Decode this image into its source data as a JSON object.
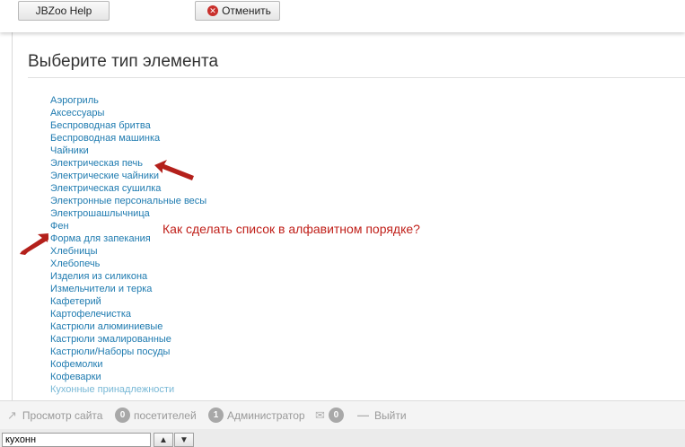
{
  "toolbar": {
    "help_label": "JBZoo Help",
    "cancel_label": "Отменить"
  },
  "page": {
    "title": "Выберите тип элемента"
  },
  "element_types": [
    "Аэрогриль",
    "Аксессуары",
    "Беспроводная бритва",
    "Беспроводная машинка",
    "Чайники",
    "Электрическая печь",
    "Электрические чайники",
    "Электрическая сушилка",
    "Электронные персональные весы",
    "Электрошашлычница",
    "Фен",
    "Форма для запекания",
    "Хлебницы",
    "Хлебопечь",
    "Изделия из силикона",
    "Измельчители и терка",
    "Кафетерий",
    "Картофелечистка",
    "Кастрюли алюминиевые",
    "Кастрюли эмалированные",
    "Кастрюли/Наборы посуды",
    "Кофемолки",
    "Кофеварки",
    "Кухонные принадлежности"
  ],
  "annotation": {
    "question": "Как сделать список в алфавитном порядке?"
  },
  "statusbar": {
    "view_site": "Просмотр сайта",
    "visitors_count": "0",
    "visitors_label": "посетителей",
    "admin_count": "1",
    "admin_label": "Администратор",
    "messages_count": "0",
    "logout": "Выйти"
  },
  "findbar": {
    "value": "кухонн"
  },
  "colors": {
    "link": "#1f7bb0",
    "annotation": "#c0201a",
    "cancel_icon": "#c9302c"
  }
}
